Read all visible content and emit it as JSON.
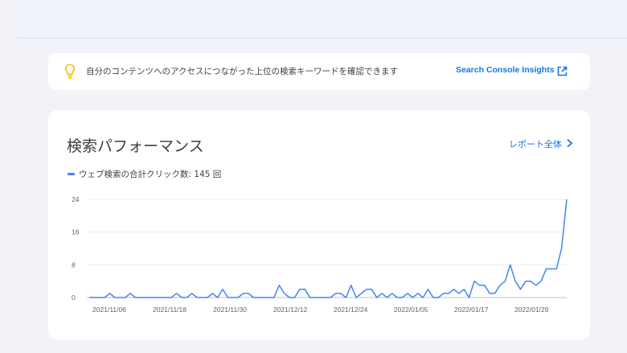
{
  "insight": {
    "message": "自分のコンテンツへのアクセスにつながった上位の検索キーワードを確認できます",
    "link_label": "Search Console Insights",
    "bulb_color": "#fbbc04",
    "link_icon": "external-link-icon"
  },
  "performance": {
    "title": "検索パフォーマンス",
    "report_link_label": "レポート全体",
    "legend_label": "ウェブ検索の合計クリック数: 145 回",
    "series_color": "#4285f4"
  },
  "chart_data": {
    "type": "line",
    "title": "",
    "xlabel": "",
    "ylabel": "",
    "ylim": [
      0,
      24
    ],
    "yticks": [
      0,
      8,
      16,
      24
    ],
    "grid": true,
    "x_tick_labels": [
      "2021/11/06",
      "2021/11/18",
      "2021/11/30",
      "2021/12/12",
      "2021/12/24",
      "2022/01/05",
      "2022/01/17",
      "2022/01/29"
    ],
    "x_start": "2021/11/02",
    "x_end": "2022/02/05",
    "series": [
      {
        "name": "ウェブ検索の合計クリック数",
        "values": [
          0,
          0,
          0,
          0,
          1,
          0,
          0,
          0,
          1,
          0,
          0,
          0,
          0,
          0,
          0,
          0,
          0,
          1,
          0,
          0,
          1,
          0,
          0,
          0,
          1,
          0,
          2,
          0,
          0,
          0,
          1,
          1,
          0,
          0,
          0,
          0,
          0,
          3,
          1,
          0,
          0,
          2,
          2,
          0,
          0,
          0,
          0,
          0,
          1,
          1,
          0,
          3,
          0,
          1,
          2,
          2,
          0,
          1,
          0,
          1,
          0,
          0,
          1,
          0,
          1,
          0,
          2,
          0,
          0,
          1,
          1,
          2,
          1,
          2,
          0,
          4,
          3,
          3,
          1,
          1,
          3,
          4,
          8,
          4,
          2,
          4,
          4,
          3,
          4,
          7,
          7,
          7,
          12,
          24
        ]
      }
    ]
  }
}
